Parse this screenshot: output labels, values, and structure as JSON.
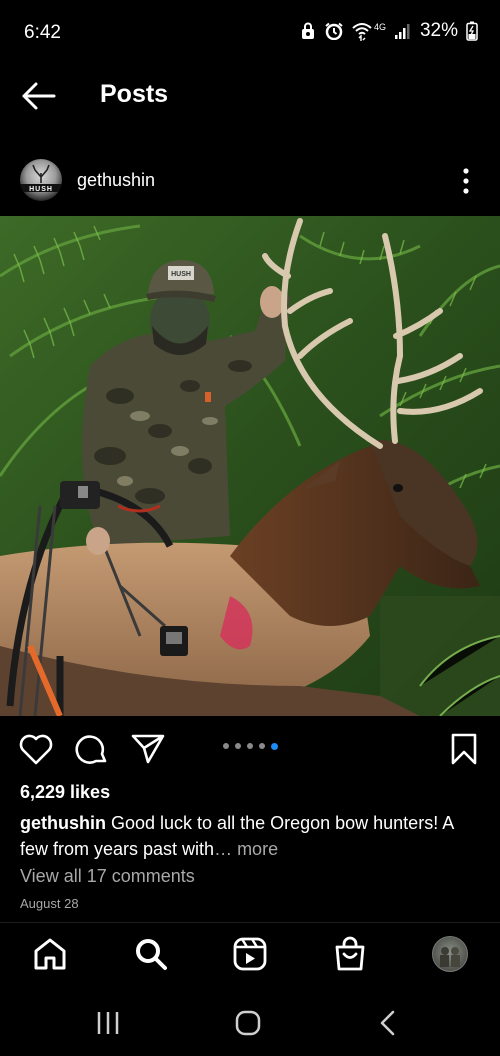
{
  "status_bar": {
    "time": "6:42",
    "network": "4G",
    "battery": "32%"
  },
  "header": {
    "title": "Posts"
  },
  "post": {
    "username": "gethushin",
    "avatar_logo_text": "HUSH",
    "cap_logo_text": "HUSH",
    "likes": "6,229 likes",
    "caption_user": "gethushin",
    "caption_text": " Good luck to all the Oregon bow hunters! A few from years past with",
    "caption_more": "… more",
    "view_comments": "View all 17 comments",
    "date": "August 28",
    "carousel": {
      "count": 5,
      "active_index": 4
    }
  },
  "colors": {
    "background": "#000000",
    "text": "#ffffff",
    "secondary_text": "#a8a8a8",
    "carousel_active": "#1d8cf8"
  },
  "icons": {
    "like": "heart-icon",
    "comment": "comment-bubble-icon",
    "share": "paper-plane-icon",
    "save": "bookmark-icon",
    "home": "home-icon",
    "search": "search-icon",
    "reels": "reels-icon",
    "shop": "shopping-bag-icon"
  }
}
